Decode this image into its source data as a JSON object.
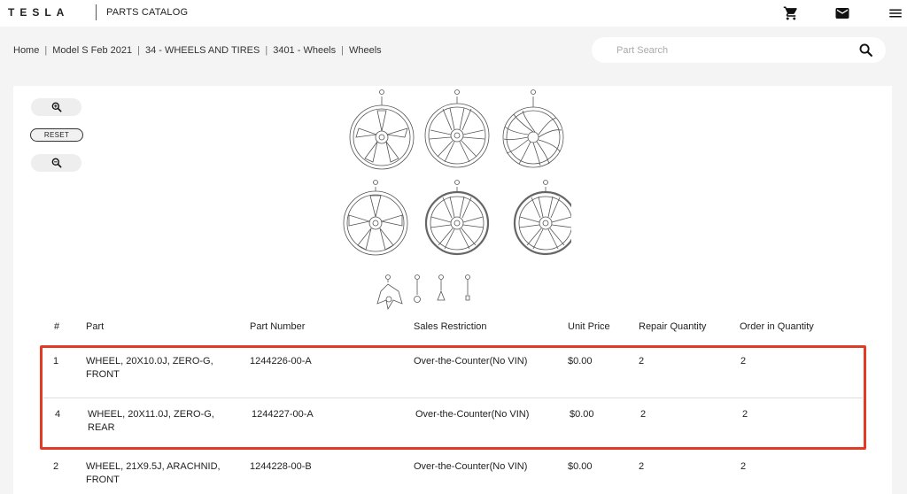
{
  "header": {
    "brand": "TESLA",
    "section": "PARTS CATALOG",
    "icons": [
      "cart-icon",
      "mail-icon",
      "menu-icon"
    ]
  },
  "breadcrumb": [
    "Home",
    "Model S Feb 2021",
    "34 - WHEELS AND TIRES",
    "3401 - Wheels",
    "Wheels"
  ],
  "search": {
    "placeholder": "Part Search",
    "value": ""
  },
  "diagram_controls": {
    "reset_label": "RESET",
    "zoom_in_icon": "zoom-in-icon",
    "zoom_out_icon": "zoom-out-icon"
  },
  "diagram_callouts": [
    "1",
    "2",
    "3",
    "4",
    "5",
    "6",
    "7",
    "8",
    "10",
    "11"
  ],
  "table": {
    "columns": [
      "#",
      "Part",
      "Part Number",
      "Sales Restriction",
      "Unit Price",
      "Repair Quantity",
      "Order in Quantity"
    ],
    "rows": [
      {
        "num": "1",
        "part_line1": "WHEEL, 20X10.0J, ZERO-G,",
        "part_line2": "FRONT",
        "part_number": "1244226-00-A",
        "restriction": "Over-the-Counter(No VIN)",
        "price": "$0.00",
        "repair_qty": "2",
        "order_qty": "2"
      },
      {
        "num": "4",
        "part_line1": "WHEEL, 20X11.0J, ZERO-G,",
        "part_line2": "REAR",
        "part_number": "1244227-00-A",
        "restriction": "Over-the-Counter(No VIN)",
        "price": "$0.00",
        "repair_qty": "2",
        "order_qty": "2"
      },
      {
        "num": "2",
        "part_line1": "WHEEL, 21X9.5J, ARACHNID,",
        "part_line2": "FRONT",
        "part_number": "1244228-00-B",
        "restriction": "Over-the-Counter(No VIN)",
        "price": "$0.00",
        "repair_qty": "2",
        "order_qty": "2"
      }
    ]
  },
  "colors": {
    "highlight": "#e13b25",
    "background": "#f4f4f4",
    "panel": "#ffffff"
  }
}
